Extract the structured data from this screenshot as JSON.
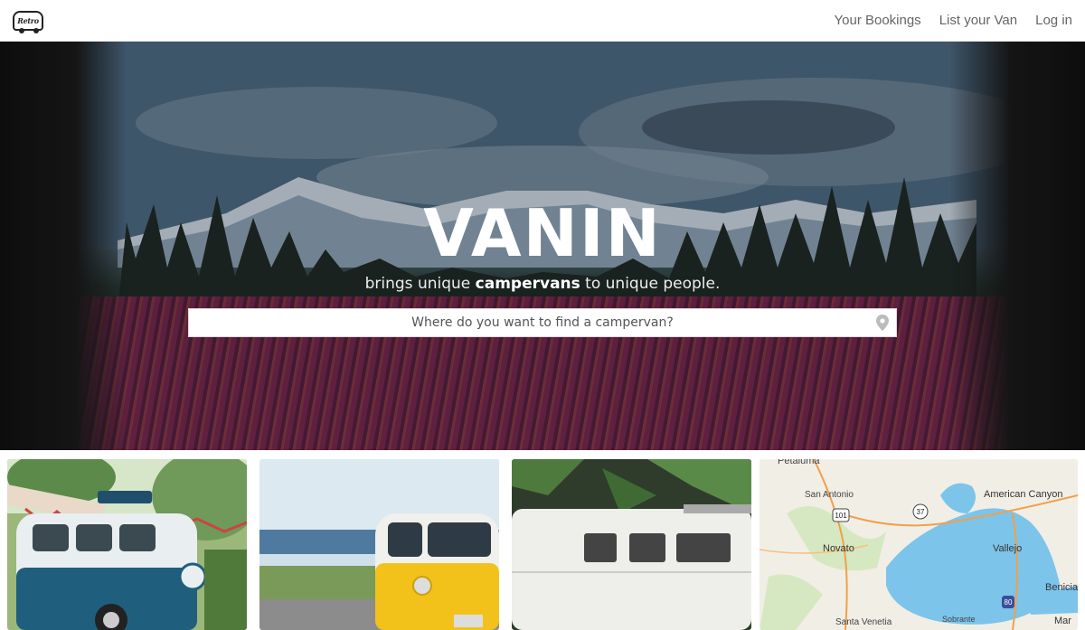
{
  "nav": {
    "logo_text": "Retro",
    "links": [
      "Your Bookings",
      "List your Van",
      "Log in"
    ]
  },
  "hero": {
    "title": "VANIN",
    "subtitle_pre": "brings unique ",
    "subtitle_bold": "campervans",
    "subtitle_post": " to unique people.",
    "search_placeholder": "Where do you want to find a campervan?",
    "search_icon": "map-pin-icon"
  },
  "map": {
    "labels": [
      "Petaluma",
      "San Antonio",
      "American Canyon",
      "Novato",
      "Vallejo",
      "Benicia",
      "Santa Venetia",
      "Sobrante",
      "Mar"
    ],
    "shields": [
      "101",
      "37",
      "80"
    ]
  },
  "colors": {
    "nav_text": "#666666",
    "hero_text": "#ffffff",
    "water": "#7cc4ea",
    "land": "#f1eee6"
  }
}
